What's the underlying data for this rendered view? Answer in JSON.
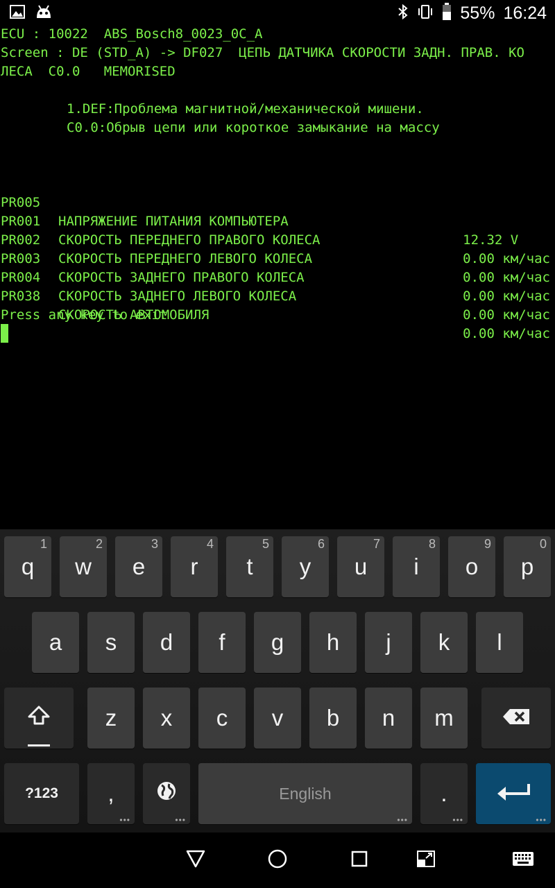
{
  "status_bar": {
    "battery_percent": "55%",
    "time": "16:24",
    "icons": [
      "image-icon",
      "android-icon",
      "bluetooth-icon",
      "vibrate-icon",
      "battery-icon"
    ]
  },
  "terminal": {
    "header_lines": [
      "ECU : 10022  ABS_Bosch8_0023_0C_A",
      "Screen : DE (STD_A) -> DF027  ЦЕПЬ ДАТЧИКА СКОРОСТИ ЗАДН. ПРАВ. КО",
      "ЛЕСА  C0.0   MEMORISED"
    ],
    "fault_lines": [
      "1.DEF:Проблема магнитной/механической мишени.",
      "C0.0:Обрыв цепи или короткое замыкание на массу"
    ],
    "parameters": [
      {
        "code": "PR005",
        "name": "НАПРЯЖЕНИЕ ПИТАНИЯ КОМПЬЮТЕРА",
        "value": "12.32 V    "
      },
      {
        "code": "PR001",
        "name": "СКОРОСТЬ ПЕРЕДНЕГО ПРАВОГО КОЛЕСА",
        "value": "0.00 км/час"
      },
      {
        "code": "PR002",
        "name": "СКОРОСТЬ ПЕРЕДНЕГО ЛЕВОГО КОЛЕСА",
        "value": "0.00 км/час"
      },
      {
        "code": "PR003",
        "name": "СКОРОСТЬ ЗАДНЕГО ПРАВОГО КОЛЕСА",
        "value": "0.00 км/час"
      },
      {
        "code": "PR004",
        "name": "СКОРОСТЬ ЗАДНЕГО ЛЕВОГО КОЛЕСА",
        "value": "0.00 км/час"
      },
      {
        "code": "PR038",
        "name": "СКОРОСТЬ АВТОМОБИЛЯ",
        "value": "0.00 км/час"
      }
    ],
    "prompt": "Press any key to exit"
  },
  "keyboard": {
    "row1": [
      {
        "label": "q",
        "hint": "1"
      },
      {
        "label": "w",
        "hint": "2"
      },
      {
        "label": "e",
        "hint": "3"
      },
      {
        "label": "r",
        "hint": "4"
      },
      {
        "label": "t",
        "hint": "5"
      },
      {
        "label": "y",
        "hint": "6"
      },
      {
        "label": "u",
        "hint": "7"
      },
      {
        "label": "i",
        "hint": "8"
      },
      {
        "label": "o",
        "hint": "9"
      },
      {
        "label": "p",
        "hint": "0"
      }
    ],
    "row2": [
      "a",
      "s",
      "d",
      "f",
      "g",
      "h",
      "j",
      "k",
      "l"
    ],
    "row3": [
      "z",
      "x",
      "c",
      "v",
      "b",
      "n",
      "m"
    ],
    "symbols_label": "?123",
    "comma_label": ",",
    "space_label": "English",
    "period_label": ".",
    "accent_color": "#0b4a6f"
  },
  "navbar": {
    "icons": [
      "back-icon",
      "home-icon",
      "recents-icon",
      "screen-resize-icon",
      "keyboard-switch-icon"
    ]
  }
}
